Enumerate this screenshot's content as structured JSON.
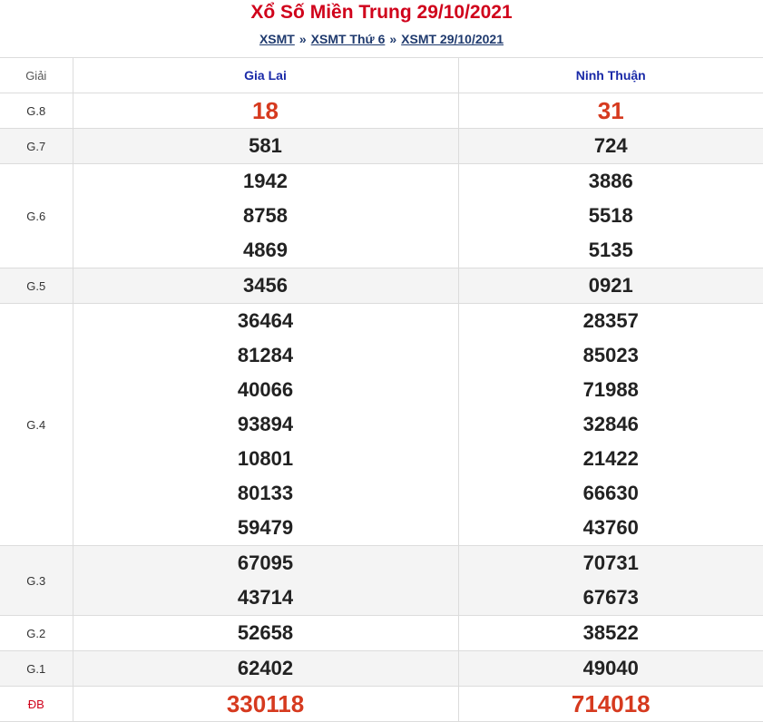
{
  "header": {
    "title": "Xổ Số Miền Trung 29/10/2021",
    "crumbs": [
      "XSMT",
      "XSMT Thứ 6",
      "XSMT 29/10/2021"
    ],
    "separator": "»"
  },
  "table": {
    "col_label": "Giải",
    "provinces": [
      "Gia Lai",
      "Ninh Thuận"
    ],
    "rows": [
      {
        "label": "G.8",
        "red": true,
        "alt": false,
        "a": [
          "18"
        ],
        "b": [
          "31"
        ]
      },
      {
        "label": "G.7",
        "red": false,
        "alt": true,
        "a": [
          "581"
        ],
        "b": [
          "724"
        ]
      },
      {
        "label": "G.6",
        "red": false,
        "alt": false,
        "a": [
          "1942",
          "8758",
          "4869"
        ],
        "b": [
          "3886",
          "5518",
          "5135"
        ]
      },
      {
        "label": "G.5",
        "red": false,
        "alt": true,
        "a": [
          "3456"
        ],
        "b": [
          "0921"
        ]
      },
      {
        "label": "G.4",
        "red": false,
        "alt": false,
        "a": [
          "36464",
          "81284",
          "40066",
          "93894",
          "10801",
          "80133",
          "59479"
        ],
        "b": [
          "28357",
          "85023",
          "71988",
          "32846",
          "21422",
          "66630",
          "43760"
        ]
      },
      {
        "label": "G.3",
        "red": false,
        "alt": true,
        "a": [
          "67095",
          "43714"
        ],
        "b": [
          "70731",
          "67673"
        ]
      },
      {
        "label": "G.2",
        "red": false,
        "alt": false,
        "a": [
          "52658"
        ],
        "b": [
          "38522"
        ]
      },
      {
        "label": "G.1",
        "red": false,
        "alt": true,
        "a": [
          "62402"
        ],
        "b": [
          "49040"
        ]
      },
      {
        "label": "ĐB",
        "red": true,
        "alt": false,
        "a": [
          "330118"
        ],
        "b": [
          "714018"
        ]
      }
    ]
  }
}
